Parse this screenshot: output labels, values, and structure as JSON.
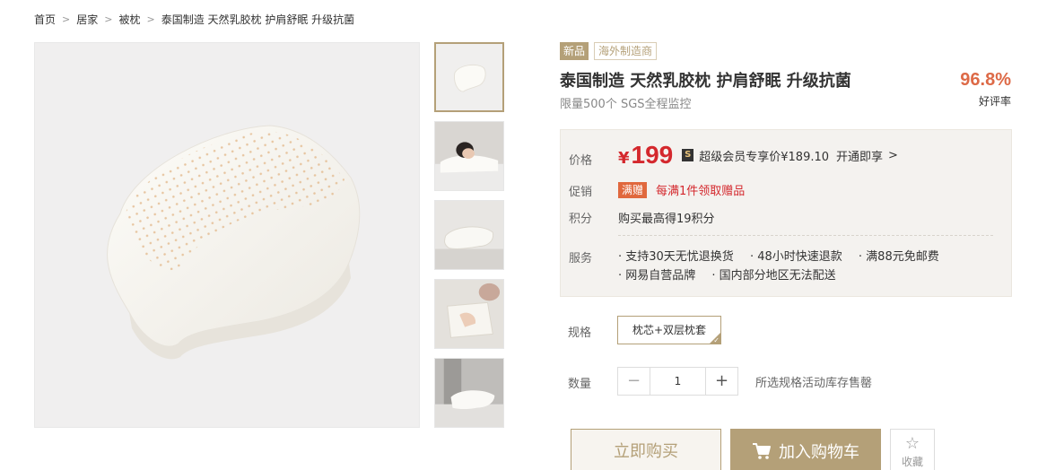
{
  "breadcrumb": [
    "首页",
    "居家",
    "被枕",
    "泰国制造 天然乳胶枕 护肩舒眠 升级抗菌"
  ],
  "product": {
    "tag_new": "新品",
    "tag_manufacturer": "海外制造商",
    "title": "泰国制造 天然乳胶枕 护肩舒眠 升级抗菌",
    "subtitle": "限量500个 SGS全程监控",
    "rating_pct": "96.8%",
    "rating_label": "好评率"
  },
  "price_box": {
    "price_label": "价格",
    "currency": "¥",
    "price": "199",
    "vip_icon": "S",
    "vip_text": "超级会员专享价¥189.10",
    "vip_link": "开通即享",
    "promo_label": "促销",
    "promo_badge": "满赠",
    "promo_text": "每满1件领取赠品",
    "points_label": "积分",
    "points_text": "购买最高得19积分",
    "service_label": "服务",
    "services": [
      "· 支持30天无忧退换货",
      "· 48小时快速退款",
      "· 满88元免邮费",
      "· 网易自营品牌",
      "· 国内部分地区无法配送"
    ]
  },
  "spec": {
    "label": "规格",
    "option": "枕芯+双层枕套"
  },
  "quantity": {
    "label": "数量",
    "minus": "−",
    "value": "1",
    "plus": "+",
    "note": "所选规格活动库存售罄"
  },
  "actions": {
    "buy_now": "立即购买",
    "add_cart": "加入购物车",
    "favorite": "收藏"
  },
  "colors": {
    "accent": "#b4a078",
    "price_red": "#d4282d",
    "rating_orange": "#dd6a47"
  }
}
